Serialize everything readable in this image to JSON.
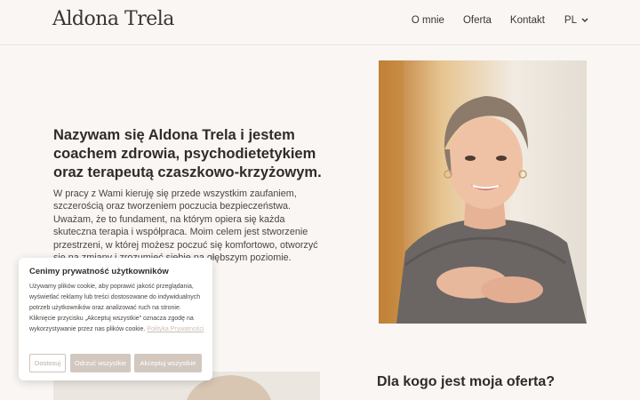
{
  "header": {
    "logo": "Aldona Trela",
    "nav": [
      "O mnie",
      "Oferta",
      "Kontakt"
    ],
    "language": "PL"
  },
  "hero": {
    "title": "Nazywam się Aldona Trela i jestem coachem zdrowia, psychodietetykiem oraz terapeutą czaszkowo-krzyżowym.",
    "text": "W pracy z Wami kieruję się przede wszystkim zaufaniem, szczerością oraz tworzeniem poczucia bezpieczeństwa. Uważam, że to fundament, na którym opiera się każda skuteczna terapia i współpraca. Moim celem jest stworzenie przestrzeni, w której możesz poczuć się komfortowo, otworzyć się na zmiany i zrozumieć siebie na głębszym poziomie."
  },
  "section": {
    "title": "Dla kogo jest moja oferta?"
  },
  "cookie": {
    "title": "Cenimy prywatność użytkowników",
    "text": "Używamy plików cookie, aby poprawić jakość przeglądania, wyświetlać reklamy lub treści dostosowane do indywidualnych potrzeb użytkowników oraz analizować ruch na stronie. Kliknięcie przycisku „Akceptuj wszystkie” oznacza zgodę na wykorzystywanie przez nas plików cookie.",
    "policy_link": "Polityka Prywatności",
    "buttons": {
      "customize": "Dostosuj",
      "reject": "Odrzuć wszystkie",
      "accept": "Akceptuj wszystkie"
    }
  }
}
